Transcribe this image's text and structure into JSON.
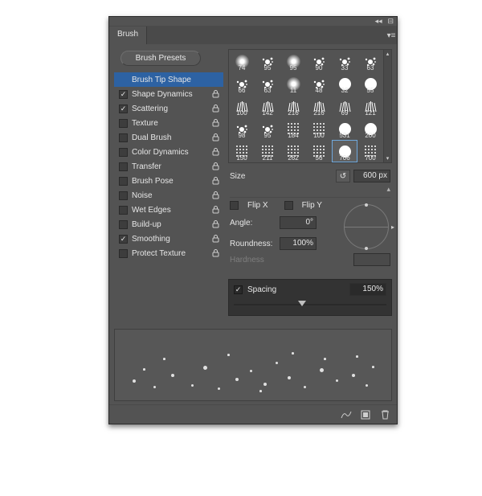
{
  "panel": {
    "title": "Brush",
    "presets_button": "Brush Presets"
  },
  "options": [
    {
      "id": "brush-tip-shape",
      "label": "Brush Tip Shape",
      "selected": true,
      "hasCheckbox": false,
      "checked": false,
      "lock": false
    },
    {
      "id": "shape-dynamics",
      "label": "Shape Dynamics",
      "selected": false,
      "hasCheckbox": true,
      "checked": true,
      "lock": true
    },
    {
      "id": "scattering",
      "label": "Scattering",
      "selected": false,
      "hasCheckbox": true,
      "checked": true,
      "lock": true
    },
    {
      "id": "texture",
      "label": "Texture",
      "selected": false,
      "hasCheckbox": true,
      "checked": false,
      "lock": true
    },
    {
      "id": "dual-brush",
      "label": "Dual Brush",
      "selected": false,
      "hasCheckbox": true,
      "checked": false,
      "lock": true
    },
    {
      "id": "color-dynamics",
      "label": "Color Dynamics",
      "selected": false,
      "hasCheckbox": true,
      "checked": false,
      "lock": true
    },
    {
      "id": "transfer",
      "label": "Transfer",
      "selected": false,
      "hasCheckbox": true,
      "checked": false,
      "lock": true
    },
    {
      "id": "brush-pose",
      "label": "Brush Pose",
      "selected": false,
      "hasCheckbox": true,
      "checked": false,
      "lock": true
    },
    {
      "id": "noise",
      "label": "Noise",
      "selected": false,
      "hasCheckbox": true,
      "checked": false,
      "lock": true
    },
    {
      "id": "wet-edges",
      "label": "Wet Edges",
      "selected": false,
      "hasCheckbox": true,
      "checked": false,
      "lock": true
    },
    {
      "id": "build-up",
      "label": "Build-up",
      "selected": false,
      "hasCheckbox": true,
      "checked": false,
      "lock": true
    },
    {
      "id": "smoothing",
      "label": "Smoothing",
      "selected": false,
      "hasCheckbox": true,
      "checked": true,
      "lock": true
    },
    {
      "id": "protect-texture",
      "label": "Protect Texture",
      "selected": false,
      "hasCheckbox": true,
      "checked": false,
      "lock": true
    }
  ],
  "brushGrid": [
    {
      "size": 74,
      "kind": "smudge"
    },
    {
      "size": 95,
      "kind": "splat"
    },
    {
      "size": 95,
      "kind": "smudge"
    },
    {
      "size": 90,
      "kind": "splat"
    },
    {
      "size": 33,
      "kind": "splat"
    },
    {
      "size": 63,
      "kind": "splat"
    },
    {
      "size": 66,
      "kind": "splat"
    },
    {
      "size": 63,
      "kind": "splat"
    },
    {
      "size": 11,
      "kind": "smudge"
    },
    {
      "size": 48,
      "kind": "splat"
    },
    {
      "size": 32,
      "kind": "circle"
    },
    {
      "size": 55,
      "kind": "circle"
    },
    {
      "size": 100,
      "kind": "grass"
    },
    {
      "size": 142,
      "kind": "grass"
    },
    {
      "size": 216,
      "kind": "grass"
    },
    {
      "size": 216,
      "kind": "grass"
    },
    {
      "size": 69,
      "kind": "grass"
    },
    {
      "size": 121,
      "kind": "grass"
    },
    {
      "size": 98,
      "kind": "splat"
    },
    {
      "size": 95,
      "kind": "splat"
    },
    {
      "size": 184,
      "kind": "dots"
    },
    {
      "size": 100,
      "kind": "dots"
    },
    {
      "size": 531,
      "kind": "circle"
    },
    {
      "size": 200,
      "kind": "circle"
    },
    {
      "size": 150,
      "kind": "dots"
    },
    {
      "size": 211,
      "kind": "dots"
    },
    {
      "size": 262,
      "kind": "dots"
    },
    {
      "size": 56,
      "kind": "dots"
    },
    {
      "size": 706,
      "kind": "circle",
      "selected": true
    },
    {
      "size": 700,
      "kind": "dots"
    }
  ],
  "size": {
    "label": "Size",
    "value": "600 px"
  },
  "flip": {
    "x_label": "Flip X",
    "y_label": "Flip Y"
  },
  "angle": {
    "label": "Angle:",
    "value": "0°"
  },
  "roundness": {
    "label": "Roundness:",
    "value": "100%"
  },
  "hardness": {
    "label": "Hardness"
  },
  "spacing": {
    "label": "Spacing",
    "value": "150%"
  }
}
